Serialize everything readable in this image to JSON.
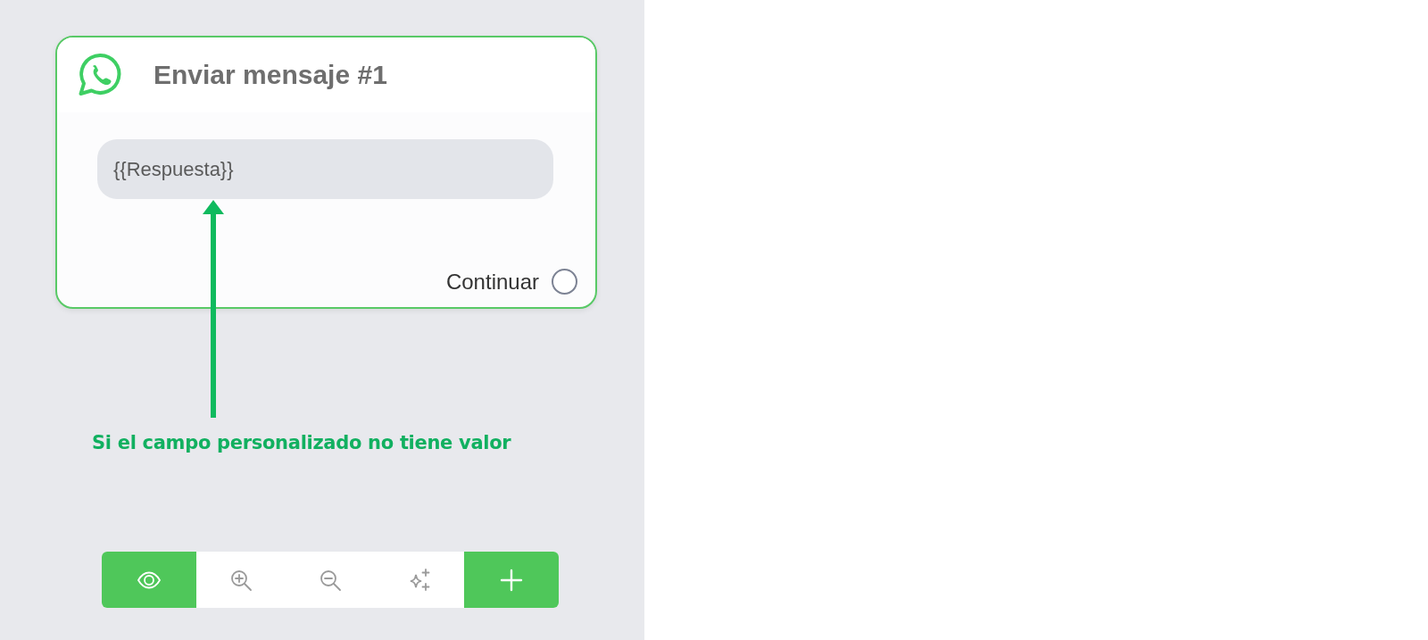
{
  "node": {
    "title": "Enviar mensaje #1",
    "field_value": "{{Respuesta}}",
    "output_label": "Continuar"
  },
  "annotation": "Si el campo personalizado no tiene valor",
  "toolbar": [
    {
      "kind": "eye"
    },
    {
      "kind": "zoom-in"
    },
    {
      "kind": "zoom-out"
    },
    {
      "kind": "sparkle"
    },
    {
      "kind": "add"
    }
  ]
}
